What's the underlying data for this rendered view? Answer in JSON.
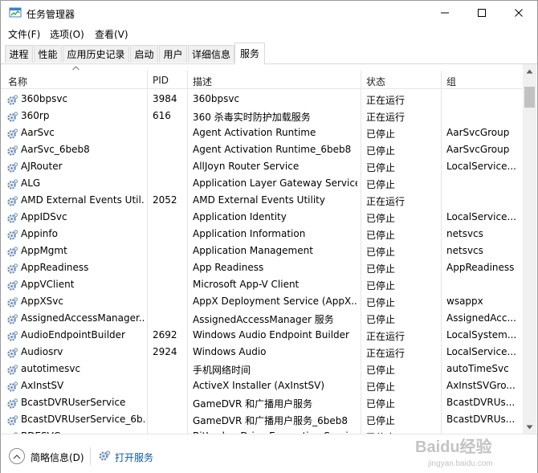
{
  "window": {
    "title": "任务管理器"
  },
  "menu": [
    "文件(F)",
    "选项(O)",
    "查看(V)"
  ],
  "tabs": [
    {
      "label": "进程",
      "active": false
    },
    {
      "label": "性能",
      "active": false
    },
    {
      "label": "应用历史记录",
      "active": false
    },
    {
      "label": "启动",
      "active": false
    },
    {
      "label": "用户",
      "active": false
    },
    {
      "label": "详细信息",
      "active": false
    },
    {
      "label": "服务",
      "active": true
    }
  ],
  "columns": {
    "name": "名称",
    "pid": "PID",
    "desc": "描述",
    "status": "状态",
    "group": "组"
  },
  "services": [
    {
      "name": "360bpsvc",
      "pid": "3984",
      "desc": "360bpsvc",
      "status": "正在运行",
      "group": ""
    },
    {
      "name": "360rp",
      "pid": "616",
      "desc": "360 杀毒实时防护加载服务",
      "status": "正在运行",
      "group": ""
    },
    {
      "name": "AarSvc",
      "pid": "",
      "desc": "Agent Activation Runtime",
      "status": "已停止",
      "group": "AarSvcGroup"
    },
    {
      "name": "AarSvc_6beb8",
      "pid": "",
      "desc": "Agent Activation Runtime_6beb8",
      "status": "已停止",
      "group": "AarSvcGroup"
    },
    {
      "name": "AJRouter",
      "pid": "",
      "desc": "AllJoyn Router Service",
      "status": "已停止",
      "group": "LocalService..."
    },
    {
      "name": "ALG",
      "pid": "",
      "desc": "Application Layer Gateway Service",
      "status": "已停止",
      "group": ""
    },
    {
      "name": "AMD External Events Util...",
      "pid": "2052",
      "desc": "AMD External Events Utility",
      "status": "正在运行",
      "group": ""
    },
    {
      "name": "AppIDSvc",
      "pid": "",
      "desc": "Application Identity",
      "status": "已停止",
      "group": "LocalService..."
    },
    {
      "name": "Appinfo",
      "pid": "",
      "desc": "Application Information",
      "status": "已停止",
      "group": "netsvcs"
    },
    {
      "name": "AppMgmt",
      "pid": "",
      "desc": "Application Management",
      "status": "已停止",
      "group": "netsvcs"
    },
    {
      "name": "AppReadiness",
      "pid": "",
      "desc": "App Readiness",
      "status": "已停止",
      "group": "AppReadiness"
    },
    {
      "name": "AppVClient",
      "pid": "",
      "desc": "Microsoft App-V Client",
      "status": "已停止",
      "group": ""
    },
    {
      "name": "AppXSvc",
      "pid": "",
      "desc": "AppX Deployment Service (AppX...",
      "status": "已停止",
      "group": "wsappx"
    },
    {
      "name": "AssignedAccessManager...",
      "pid": "",
      "desc": "AssignedAccessManager 服务",
      "status": "已停止",
      "group": "AssignedAcc..."
    },
    {
      "name": "AudioEndpointBuilder",
      "pid": "2692",
      "desc": "Windows Audio Endpoint Builder",
      "status": "正在运行",
      "group": "LocalSystem..."
    },
    {
      "name": "Audiosrv",
      "pid": "2924",
      "desc": "Windows Audio",
      "status": "正在运行",
      "group": "LocalService..."
    },
    {
      "name": "autotimesvc",
      "pid": "",
      "desc": "手机网络时间",
      "status": "已停止",
      "group": "autoTimeSvc"
    },
    {
      "name": "AxInstSV",
      "pid": "",
      "desc": "ActiveX Installer (AxInstSV)",
      "status": "已停止",
      "group": "AxInstSVGro..."
    },
    {
      "name": "BcastDVRUserService",
      "pid": "",
      "desc": "GameDVR 和广播用户服务",
      "status": "已停止",
      "group": "BcastDVRUs..."
    },
    {
      "name": "BcastDVRUserService_6b...",
      "pid": "",
      "desc": "GameDVR 和广播用户服务_6beb8",
      "status": "已停止",
      "group": "BcastDVRUs..."
    },
    {
      "name": "BDESVC",
      "pid": "",
      "desc": "BitLocker Drive Encryption Service",
      "status": "已停止",
      "group": ""
    }
  ],
  "footer": {
    "fewer_details": "简略信息(D)",
    "open_services": "打开服务"
  },
  "watermark": {
    "brand": "Baidu经验",
    "url": "jingyan.baidu.com"
  },
  "colors": {
    "link": "#0b5aa6",
    "gear": "#6f8fb8",
    "accent_blue": "#2d7fd2"
  }
}
